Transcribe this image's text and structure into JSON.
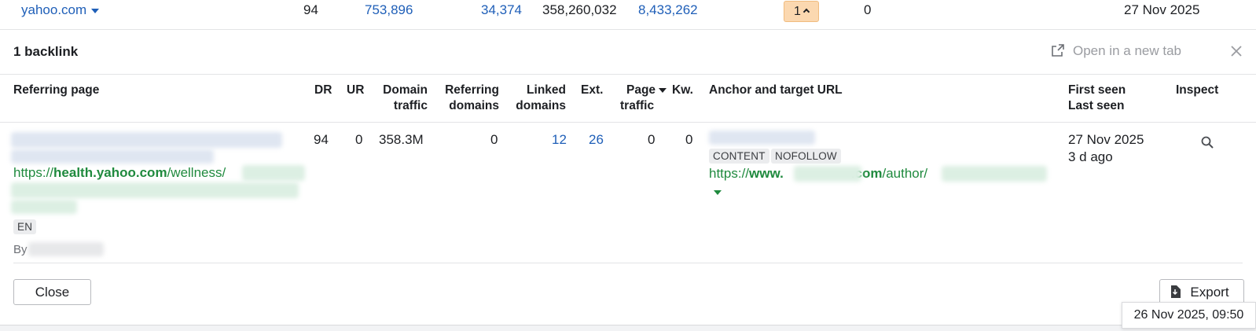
{
  "summary_row": {
    "domain": "yahoo.com",
    "dr": "94",
    "referring_domains": "753,896",
    "backlinks": "34,374",
    "traffic": "358,260,032",
    "keywords": "8,433,262",
    "links_count": "1",
    "new_links": "0",
    "first_seen": "27 Nov 2025"
  },
  "panel": {
    "title": "1 backlink",
    "open_new_tab": "Open in a new tab"
  },
  "table": {
    "headers": {
      "referring_page": "Referring page",
      "dr": "DR",
      "ur": "UR",
      "domain_traffic_1": "Domain",
      "domain_traffic_2": "traffic",
      "referring_domains_1": "Referring",
      "referring_domains_2": "domains",
      "linked_domains_1": "Linked",
      "linked_domains_2": "domains",
      "ext": "Ext.",
      "page_traffic_1": "Page",
      "page_traffic_2": "traffic",
      "kw": "Kw.",
      "anchor_url": "Anchor and target URL",
      "first_seen": "First seen",
      "last_seen": "Last seen",
      "inspect": "Inspect"
    },
    "row": {
      "referring_url_prefix": "https://",
      "referring_url_host": "health.yahoo.com",
      "referring_url_path": "/wellness/",
      "language": "EN",
      "by": "By",
      "dr": "94",
      "ur": "0",
      "domain_traffic": "358.3M",
      "referring_domains": "0",
      "linked_domains": "12",
      "ext": "26",
      "page_traffic": "0",
      "kw": "0",
      "tags": [
        "CONTENT",
        "NOFOLLOW"
      ],
      "target_url_prefix": "https://",
      "target_url_host_start": "www.",
      "target_url_host_end": ".com",
      "target_url_path": "/author/",
      "first_seen": "27 Nov 2025",
      "last_seen": "3 d ago"
    }
  },
  "footer": {
    "close_label": "Close",
    "export_label": "Export"
  },
  "tooltip": {
    "text": "26 Nov 2025, 09:50"
  },
  "colors": {
    "link_blue": "#1f5fb8",
    "url_green": "#1f8a3e",
    "badge_orange": "#fbd8b0"
  }
}
